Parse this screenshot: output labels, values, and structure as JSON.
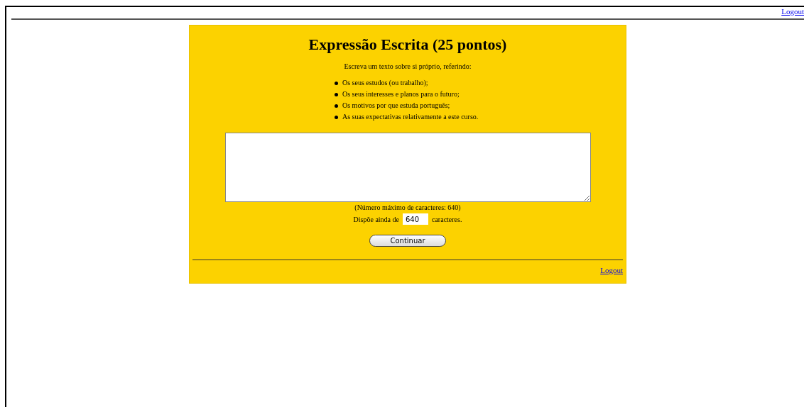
{
  "header": {
    "logout_link": "Logout"
  },
  "form": {
    "title": "Expressão Escrita (25 pontos)",
    "instructions": "Escreva um texto sobre si próprio, referindo:",
    "items": [
      "Os seus estudos (ou trabalho);",
      "Os seus interesses e planos para o futuro;",
      "Os motivos por que estuda português;",
      "As suas expectativas relativamente a este curso."
    ],
    "max_chars_note": "(Número máximo de caracteres: 640)",
    "remaining_before": "Dispõe ainda de",
    "remaining_value": "640",
    "remaining_after": "caracteres.",
    "continue_button": "Continuar",
    "logout_link": "Logout"
  }
}
